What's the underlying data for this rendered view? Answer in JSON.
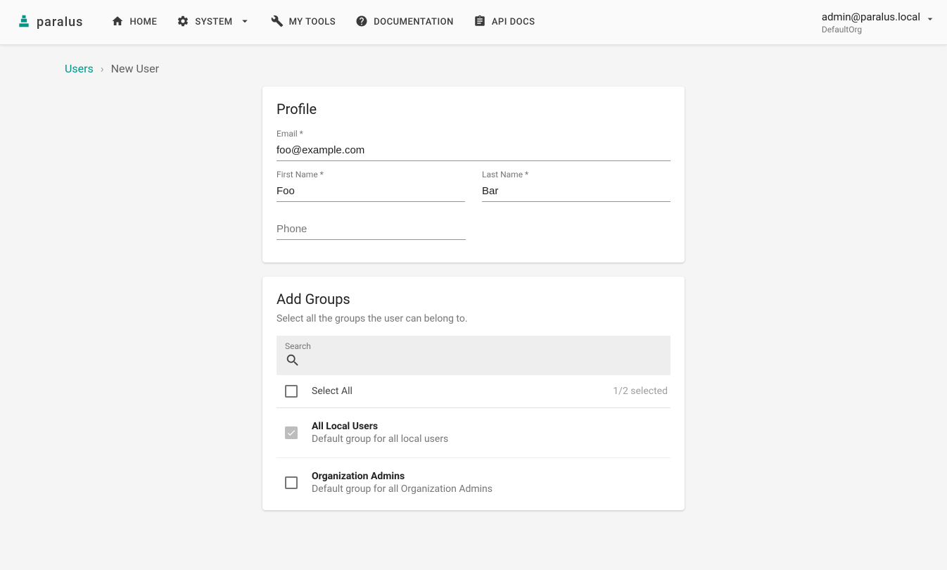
{
  "header": {
    "brand": "paralus",
    "nav": {
      "home": "HOME",
      "system": "SYSTEM",
      "my_tools": "MY TOOLS",
      "documentation": "DOCUMENTATION",
      "api_docs": "API DOCS"
    },
    "user": {
      "email": "admin@paralus.local",
      "org": "DefaultOrg"
    }
  },
  "breadcrumb": {
    "parent": "Users",
    "sep": "›",
    "current": "New User"
  },
  "profile": {
    "title": "Profile",
    "email_label": "Email *",
    "email_value": "foo@example.com",
    "first_name_label": "First Name *",
    "first_name_value": "Foo",
    "last_name_label": "Last Name *",
    "last_name_value": "Bar",
    "phone_placeholder": "Phone",
    "phone_value": ""
  },
  "groups": {
    "title": "Add Groups",
    "subtitle": "Select all the groups the user can belong to.",
    "search_label": "Search",
    "select_all_label": "Select All",
    "selected_text": "1/2 selected",
    "items": [
      {
        "name": "All Local Users",
        "desc": "Default group for all local users",
        "checked": true
      },
      {
        "name": "Organization Admins",
        "desc": "Default group for all Organization Admins",
        "checked": false
      }
    ]
  }
}
